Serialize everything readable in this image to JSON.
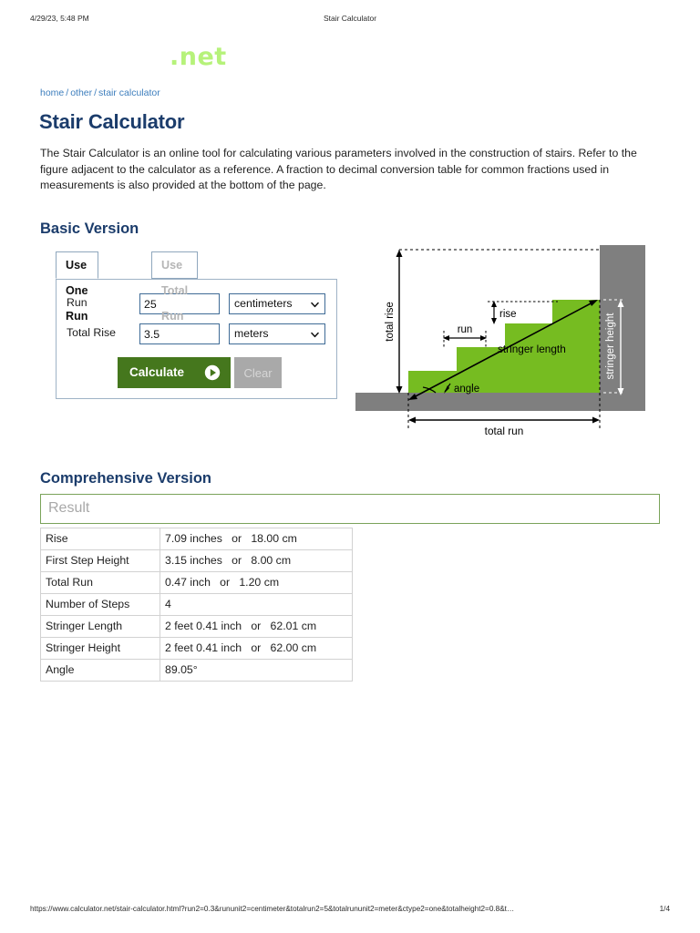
{
  "print_header": {
    "date": "4/29/23, 5:48 PM",
    "title": "Stair Calculator"
  },
  "logo": {
    "text": ".net"
  },
  "breadcrumb": {
    "home": "home",
    "other": "other",
    "current": "stair calculator",
    "separator": "/"
  },
  "page": {
    "title": "Stair Calculator",
    "intro": "The Stair Calculator is an online tool for calculating various parameters involved in the construction of stairs. Refer to the figure adjacent to the calculator as a reference. A fraction to decimal conversion table for common fractions used in measurements is also provided at the bottom of the page."
  },
  "sections": {
    "basic": "Basic Version",
    "comprehensive": "Comprehensive Version"
  },
  "calculator": {
    "tabs": [
      {
        "label": "Use One Run",
        "active": true
      },
      {
        "label": "Use Total Run",
        "active": false
      }
    ],
    "fields": [
      {
        "label": "Run",
        "value": "25",
        "unit": "centimeters"
      },
      {
        "label": "Total Rise",
        "value": "3.5",
        "unit": "meters"
      }
    ],
    "calculate_label": "Calculate",
    "clear_label": "Clear"
  },
  "diagram": {
    "labels": {
      "total_rise": "total rise",
      "rise": "rise",
      "run": "run",
      "stringer_length": "stringer length",
      "angle": "angle",
      "stringer_height": "stringer height",
      "total_run": "total run"
    },
    "colors": {
      "stairs": "#76bc21",
      "wall": "#7f7f7f"
    },
    "steps": 4
  },
  "result": {
    "placeholder": "Result"
  },
  "results_table": {
    "rows": [
      {
        "key": "Rise",
        "value": "7.09 inches   or   18.00 cm"
      },
      {
        "key": "First Step Height",
        "value": "3.15 inches   or   8.00 cm"
      },
      {
        "key": "Total Run",
        "value": "0.47 inch   or   1.20 cm"
      },
      {
        "key": "Number of Steps",
        "value": "4"
      },
      {
        "key": "Stringer Length",
        "value": "2 feet 0.41 inch   or   62.01 cm"
      },
      {
        "key": "Stringer Height",
        "value": "2 feet 0.41 inch   or   62.00 cm"
      },
      {
        "key": "Angle",
        "value": "89.05°"
      }
    ]
  },
  "footer": {
    "url": "https://www.calculator.net/stair-calculator.html?run2=0.3&rununit2=centimeter&totalrun2=5&totalrununit2=meter&ctype2=one&totalheight2=0.8&t…",
    "page": "1/4"
  }
}
